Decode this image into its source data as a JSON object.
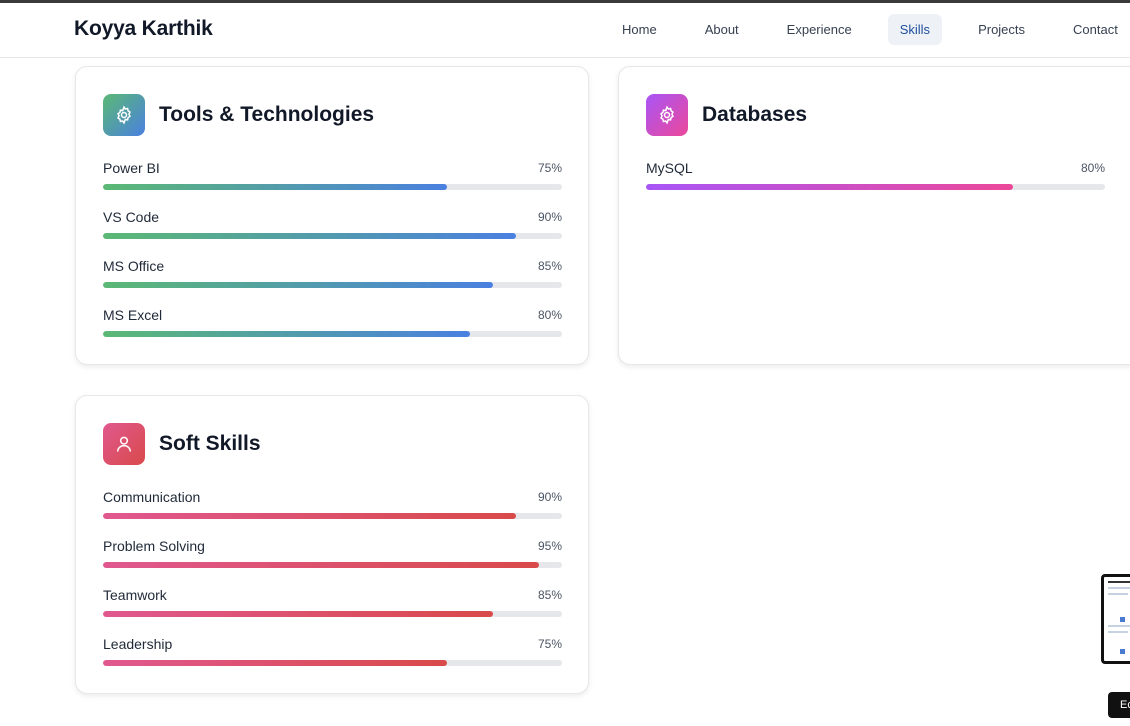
{
  "brand": "Koyya Karthik",
  "nav": [
    {
      "label": "Home",
      "active": false
    },
    {
      "label": "About",
      "active": false
    },
    {
      "label": "Experience",
      "active": false
    },
    {
      "label": "Skills",
      "active": true
    },
    {
      "label": "Projects",
      "active": false
    },
    {
      "label": "Contact",
      "active": false
    }
  ],
  "cards": {
    "tools": {
      "title": "Tools & Technologies",
      "icon": "gear-icon",
      "gradient": [
        "#5bb974",
        "#4a80e0"
      ],
      "skills": [
        {
          "name": "Power BI",
          "percent_label": "75%",
          "percent": 75
        },
        {
          "name": "VS Code",
          "percent_label": "90%",
          "percent": 90
        },
        {
          "name": "MS Office",
          "percent_label": "85%",
          "percent": 85
        },
        {
          "name": "MS Excel",
          "percent_label": "80%",
          "percent": 80
        }
      ]
    },
    "databases": {
      "title": "Databases",
      "icon": "gear-icon",
      "gradient": [
        "#a855f7",
        "#ec4899"
      ],
      "skills": [
        {
          "name": "MySQL",
          "percent_label": "80%",
          "percent": 80
        }
      ]
    },
    "soft": {
      "title": "Soft Skills",
      "icon": "user-icon",
      "gradient": [
        "#e0588f",
        "#d94a4a"
      ],
      "skills": [
        {
          "name": "Communication",
          "percent_label": "90%",
          "percent": 90
        },
        {
          "name": "Problem Solving",
          "percent_label": "95%",
          "percent": 95
        },
        {
          "name": "Teamwork",
          "percent_label": "85%",
          "percent": 85
        },
        {
          "name": "Leadership",
          "percent_label": "75%",
          "percent": 75
        }
      ]
    }
  },
  "corner_badge": "Ec"
}
